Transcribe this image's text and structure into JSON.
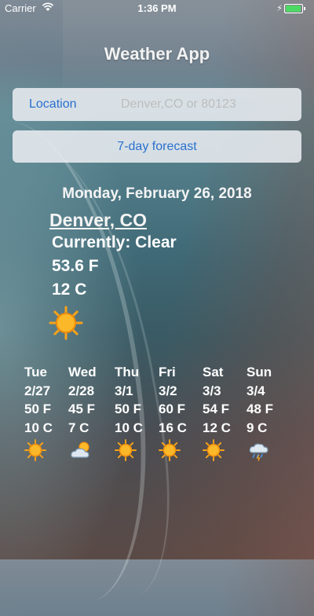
{
  "status": {
    "carrier": "Carrier",
    "time": "1:36 PM"
  },
  "app": {
    "title": "Weather App"
  },
  "location": {
    "label": "Location",
    "placeholder": "Denver,CO or 80123",
    "value": ""
  },
  "forecast_button": {
    "label": "7-day forecast"
  },
  "current": {
    "date": "Monday, February 26, 2018",
    "city": "Denver, CO",
    "condition": "Currently: Clear",
    "temp_f": "53.6 F",
    "temp_c": "12 C",
    "icon": "sun-icon"
  },
  "forecast": [
    {
      "day": "Tue",
      "date": "2/27",
      "temp_f": "50 F",
      "temp_c": "10 C",
      "icon": "sun-icon"
    },
    {
      "day": "Wed",
      "date": "2/28",
      "temp_f": "45 F",
      "temp_c": "7 C",
      "icon": "partly-cloudy-icon"
    },
    {
      "day": "Thu",
      "date": "3/1",
      "temp_f": "50 F",
      "temp_c": "10 C",
      "icon": "sun-icon"
    },
    {
      "day": "Fri",
      "date": "3/2",
      "temp_f": "60 F",
      "temp_c": "16 C",
      "icon": "sun-icon"
    },
    {
      "day": "Sat",
      "date": "3/3",
      "temp_f": "54 F",
      "temp_c": "12 C",
      "icon": "sun-icon"
    },
    {
      "day": "Sun",
      "date": "3/4",
      "temp_f": "48 F",
      "temp_c": "9 C",
      "icon": "rain-cloud-icon"
    }
  ],
  "colors": {
    "link_blue": "#2a6fcf",
    "battery_green": "#4cd964",
    "sun_orange": "#f7a21a"
  }
}
